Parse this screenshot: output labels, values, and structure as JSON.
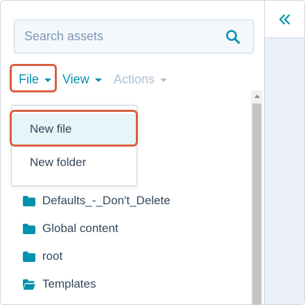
{
  "search": {
    "placeholder": "Search assets"
  },
  "toolbar": {
    "file_label": "File",
    "view_label": "View",
    "actions_label": "Actions"
  },
  "file_menu": {
    "items": [
      {
        "label": "New file"
      },
      {
        "label": "New folder"
      }
    ]
  },
  "folders": [
    {
      "name": "Defaults_-_Don't_Delete",
      "icon": "folder-icon"
    },
    {
      "name": "Global content",
      "icon": "folder-icon"
    },
    {
      "name": "root",
      "icon": "folder-icon"
    },
    {
      "name": "Templates",
      "icon": "folder-open-icon"
    }
  ],
  "colors": {
    "accent": "#0091ae",
    "disabled": "#b0c1d4",
    "highlight_annotation": "#d95f3f",
    "text": "#33475b",
    "hover": "#e5f5f8"
  },
  "rail": {
    "icon": "double-chevron-left-icon"
  }
}
